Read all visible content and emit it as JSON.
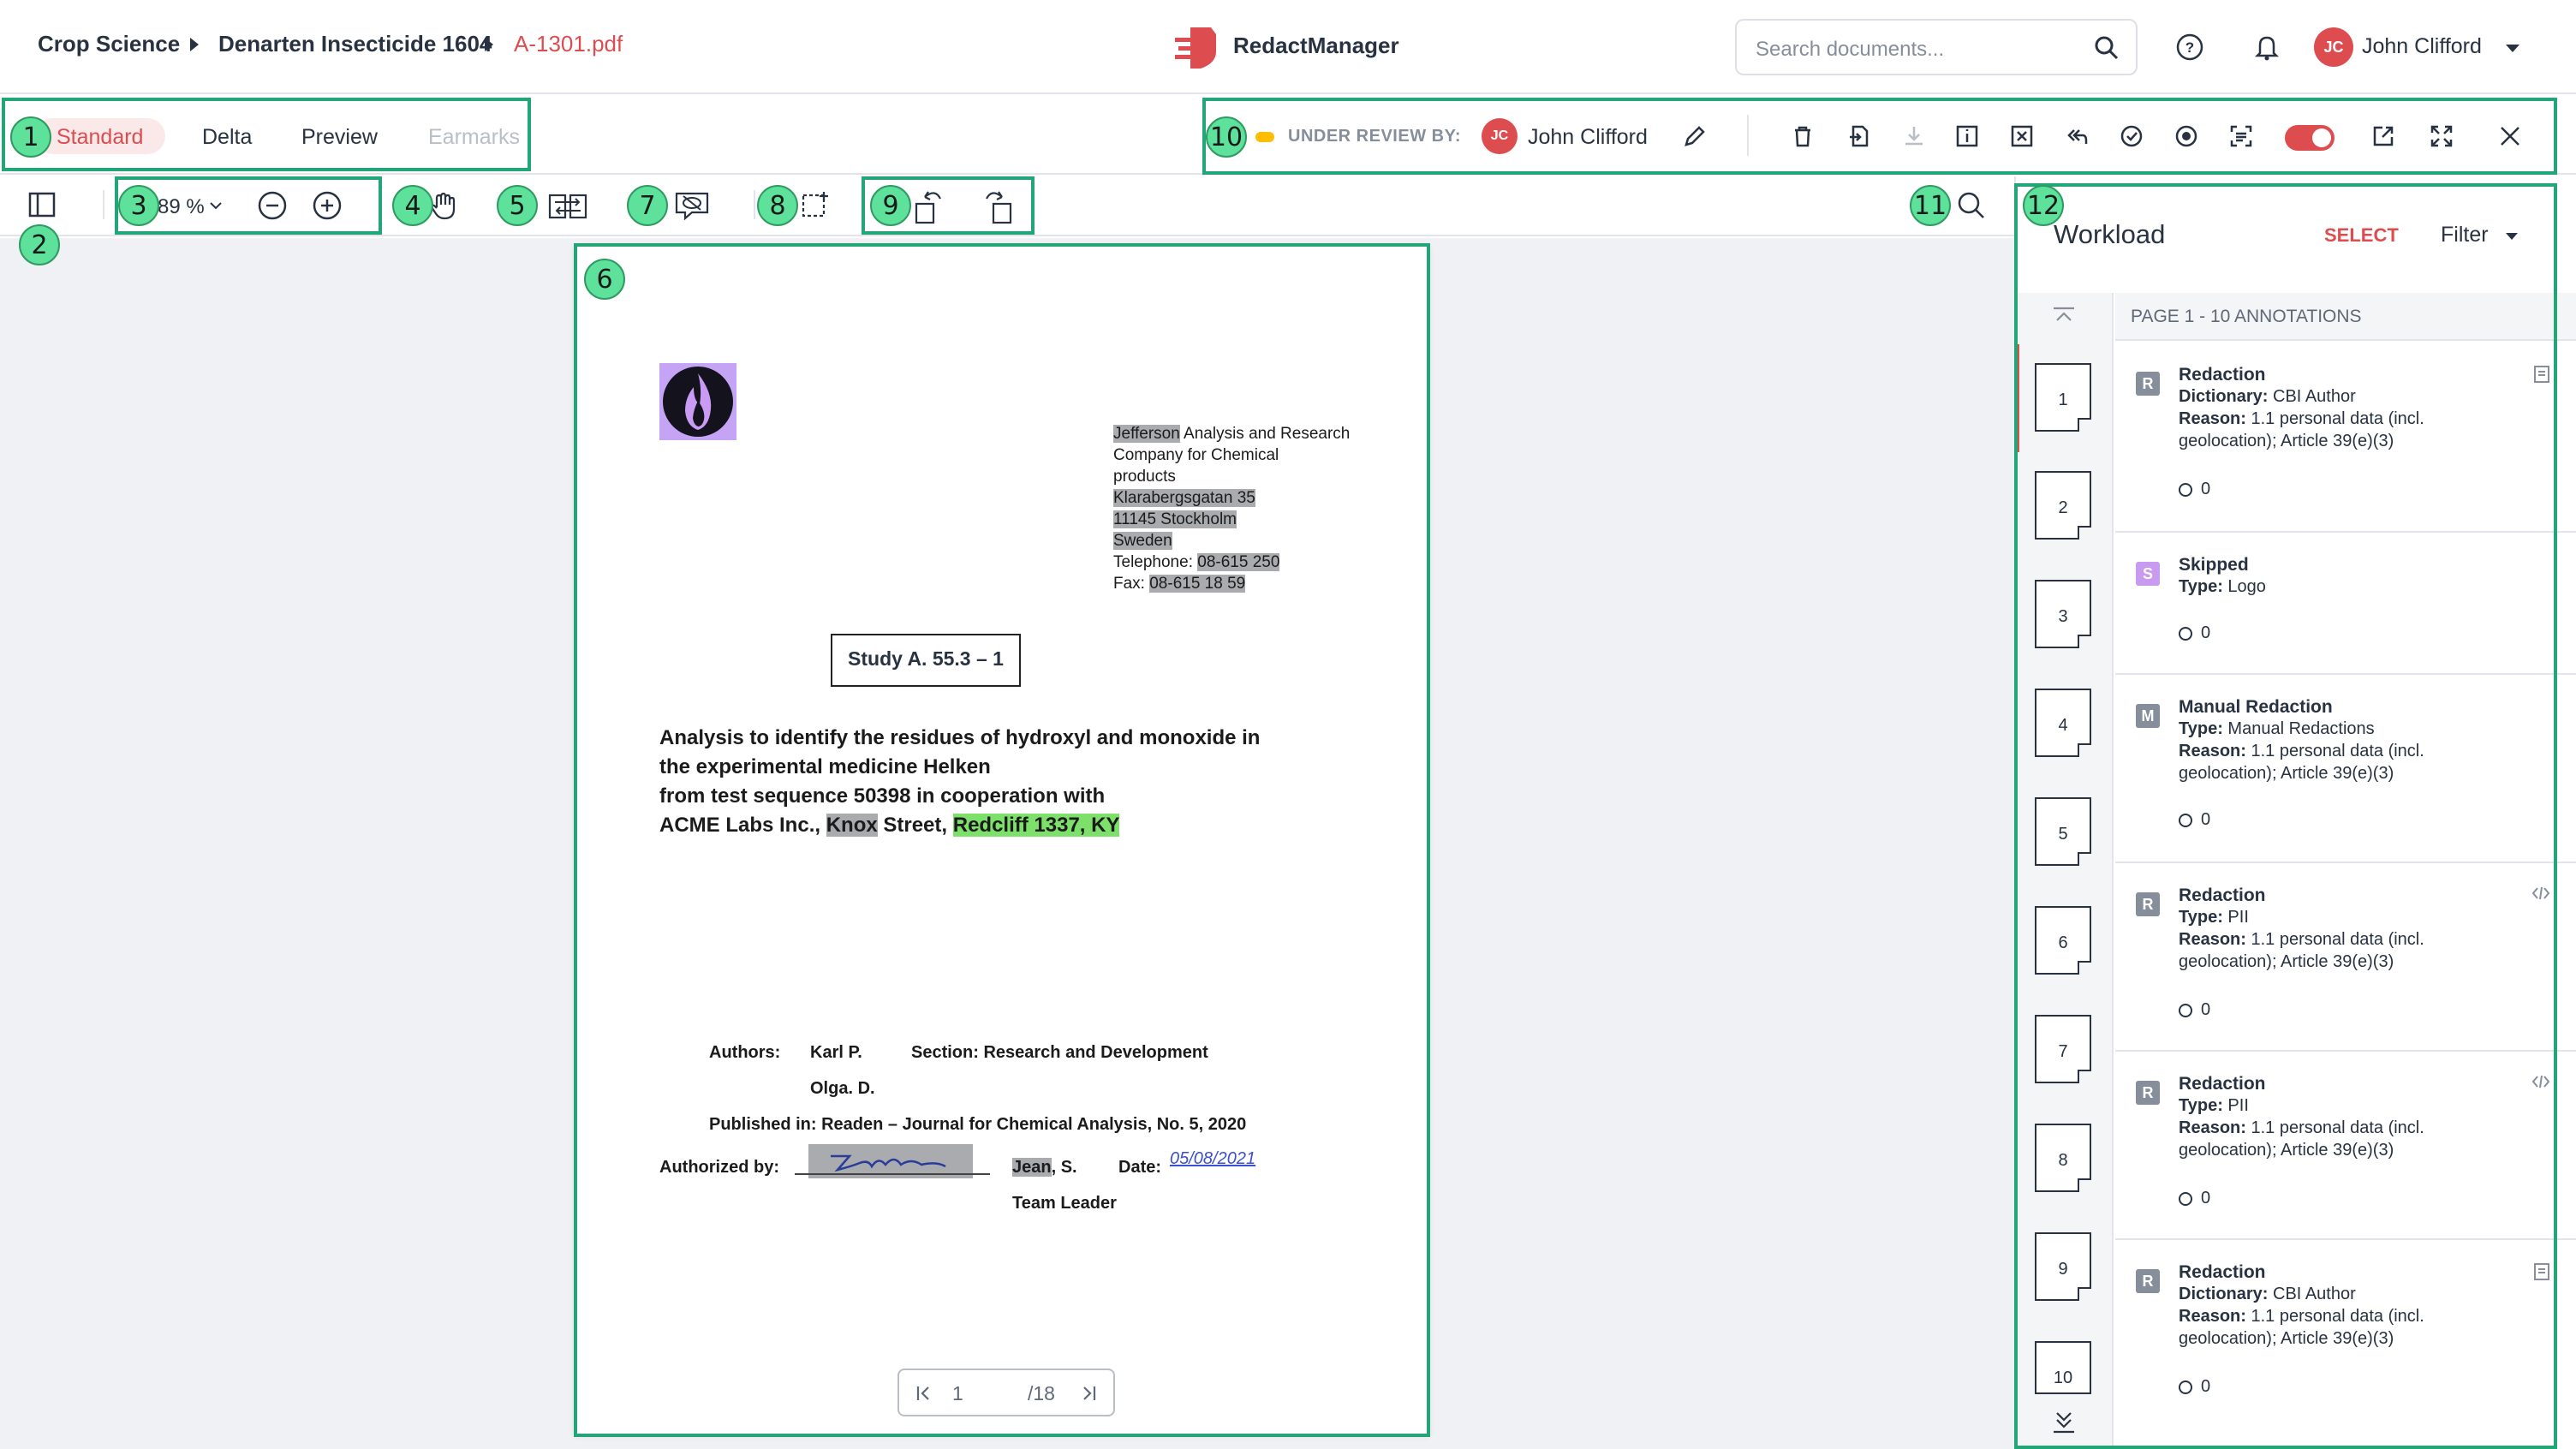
{
  "breadcrumb": [
    "Crop Science",
    "Denarten Insecticide 1604",
    "A-1301.pdf"
  ],
  "brand": {
    "name": "RedactManager",
    "color": "#dd4d50"
  },
  "search": {
    "placeholder": "Search documents..."
  },
  "user": {
    "initials": "JC",
    "name": "John Clifford"
  },
  "view_tabs": {
    "standard": "Standard",
    "delta": "Delta",
    "preview": "Preview",
    "earmarks": "Earmarks"
  },
  "review": {
    "label": "UNDER REVIEW BY:",
    "reviewer_initials": "JC",
    "reviewer_name": "John Clifford"
  },
  "toolbar_icons": [
    "trash-icon",
    "export-icon",
    "download-icon",
    "info-icon",
    "excel-icon",
    "undo-all-icon",
    "approve-icon",
    "record-icon",
    "ocr-scan-icon",
    "toggle",
    "open-external-icon",
    "fullscreen-icon",
    "close-icon"
  ],
  "doc_tools": {
    "zoom": "89 %"
  },
  "document": {
    "address": {
      "company_hl": "Jefferson",
      "company_rest": " Analysis and Research",
      "line2": "Company for Chemical",
      "line3": "products",
      "street": "Klarabergsgatan 35",
      "city": "11145 Stockholm",
      "country": "Sweden",
      "tel_label": "Telephone: ",
      "tel": "08-615 250",
      "fax_label": "Fax: ",
      "fax": "08-615 18 59"
    },
    "study": "Study A. 55.3 – 1",
    "title": {
      "line1": "Analysis to identify the residues of hydroxyl and monoxide in",
      "line2": "the experimental medicine Helken",
      "line3": "from test sequence 50398 in cooperation with",
      "line4_a": "ACME Labs Inc., ",
      "line4_knox": "Knox",
      "line4_b": " Street, ",
      "line4_city": "Redcliff 1337, KY"
    },
    "authors_label": "Authors:",
    "author1": "Karl P.",
    "author2": "Olga. D.",
    "section": "Section: Research and Development",
    "published": "Published in: Readen – Journal for Chemical Analysis, No. 5, 2020",
    "authorized_label": "Authorized by:",
    "signer_hl": "Jean",
    "signer_rest": ", S.",
    "date_label": "Date:",
    "date_value": "05/08/2021",
    "role": "Team Leader"
  },
  "pager": {
    "current": "1",
    "total": "/18"
  },
  "workload": {
    "title": "Workload",
    "select": "SELECT",
    "filter": "Filter",
    "page_header": "PAGE 1 - 10 ANNOTATIONS",
    "pages": [
      "1",
      "2",
      "3",
      "4",
      "5",
      "6",
      "7",
      "8",
      "9",
      "10"
    ],
    "annotations": [
      {
        "badge": "R",
        "badge_color": "#868e9b",
        "title": "Redaction",
        "l1k": "Dictionary:",
        "l1v": " CBI Author",
        "l2k": "Reason:",
        "l2v": " 1.1 personal data (incl.",
        "l3": "geolocation); Article 39(e)(3)",
        "comments": "0"
      },
      {
        "badge": "S",
        "badge_color": "#c89af0",
        "title": "Skipped",
        "l1k": "Type:",
        "l1v": " Logo",
        "comments": "0"
      },
      {
        "badge": "M",
        "badge_color": "#868e9b",
        "title": "Manual Redaction",
        "l1k": "Type:",
        "l1v": " Manual Redactions",
        "l2k": "Reason:",
        "l2v": " 1.1 personal data (incl.",
        "l3": "geolocation); Article 39(e)(3)",
        "comments": "0"
      },
      {
        "badge": "R",
        "badge_color": "#868e9b",
        "title": "Redaction",
        "l1k": "Type:",
        "l1v": " PII",
        "l2k": "Reason:",
        "l2v": " 1.1 personal data (incl.",
        "l3": "geolocation); Article 39(e)(3)",
        "comments": "0"
      },
      {
        "badge": "R",
        "badge_color": "#868e9b",
        "title": "Redaction",
        "l1k": "Type:",
        "l1v": " PII",
        "l2k": "Reason:",
        "l2v": " 1.1 personal data (incl.",
        "l3": "geolocation); Article 39(e)(3)",
        "comments": "0"
      },
      {
        "badge": "R",
        "badge_color": "#868e9b",
        "title": "Redaction",
        "l1k": "Dictionary:",
        "l1v": " CBI Author",
        "l2k": "Reason:",
        "l2v": " 1.1 personal data (incl.",
        "l3": "geolocation); Article 39(e)(3)",
        "comments": "0"
      }
    ]
  },
  "callouts": [
    "1",
    "2",
    "3",
    "4",
    "5",
    "6",
    "7",
    "8",
    "9",
    "10",
    "11",
    "12"
  ]
}
